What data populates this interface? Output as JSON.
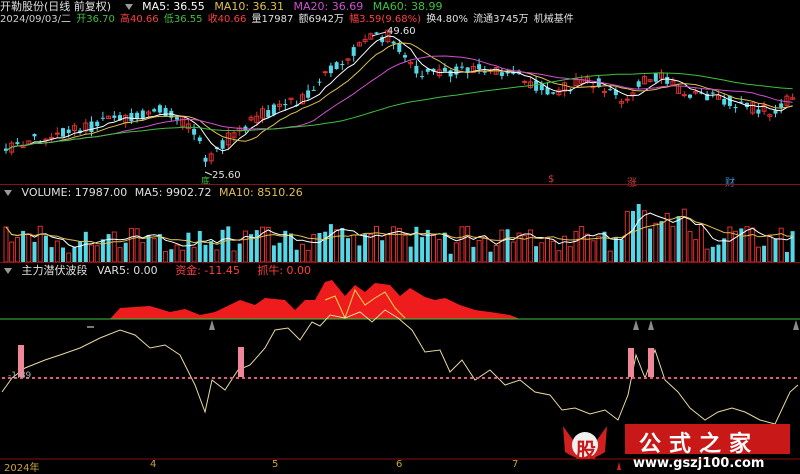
{
  "title_bar": {
    "stock": "开勒股份(日线 前复权)",
    "ma5": "MA5: 36.55",
    "ma10": "MA10: 36.31",
    "ma20": "MA20: 36.69",
    "ma60": "MA60: 38.99",
    "colors": {
      "ma5": "#ffffff",
      "ma10": "#e0c050",
      "ma20": "#d050d0",
      "ma60": "#40c040"
    }
  },
  "info_bar": {
    "date": "2024/09/03/二",
    "open": "开36.70",
    "high": "高40.66",
    "low": "低36.55",
    "close": "收40.66",
    "volume": "量17987",
    "amount": "额6942万",
    "change": "幅3.59(9.68%)",
    "turnover": "换4.80%",
    "float": "流通3745万",
    "industry": "机械基件"
  },
  "price_markers": {
    "high_label": "49.60",
    "low_label": "25.60",
    "low_tag": "底"
  },
  "event_tags": [
    {
      "text": "$",
      "color": "#d04040"
    },
    {
      "text": "涨",
      "color": "#d04040"
    },
    {
      "text": "财",
      "color": "#3b8fd0"
    }
  ],
  "volume_bar": {
    "label": "VOLUME: 17987.00",
    "ma5": "MA5: 9902.72",
    "ma10": "MA10: 8510.26"
  },
  "indicator_bar": {
    "label": "主力潜伏波段",
    "var5": "VAR5: 0.00",
    "fund": "资金: -11.45",
    "grab": "抓牛: 0.00"
  },
  "indicator_marker": "-1.89",
  "xaxis": [
    "2024年",
    "4",
    "5",
    "6",
    "7"
  ],
  "watermark": {
    "brand": "股",
    "site_name": "公式之家",
    "url": "www.gszj100.com"
  }
}
